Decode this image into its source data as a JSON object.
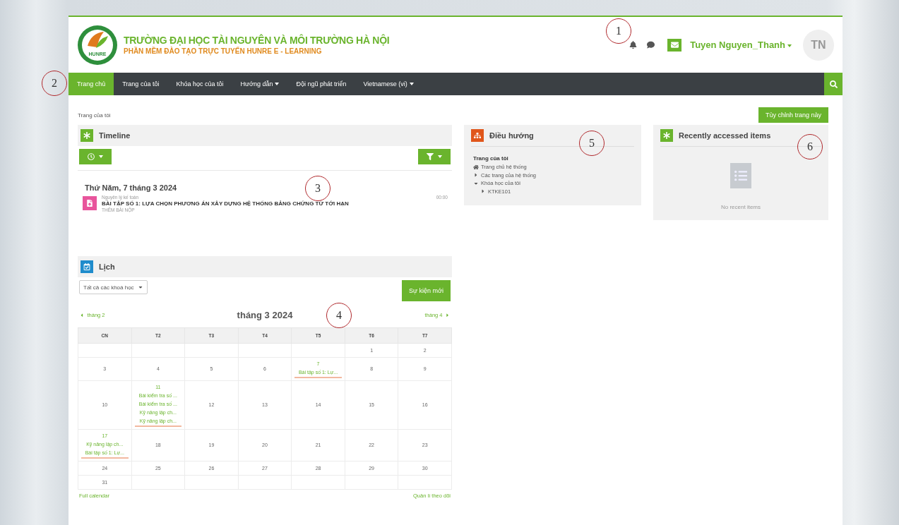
{
  "header": {
    "logo_text": "HUNRE",
    "title": "TRƯỜNG ĐẠI HỌC TÀI NGUYÊN VÀ MÔI TRƯỜNG HÀ NỘI",
    "subtitle": "PHẦN MỀM ĐÀO TẠO TRỰC TUYẾN HUNRE E - LEARNING",
    "user_name": "Tuyen Nguyen_Thanh",
    "avatar_initials": "TN"
  },
  "nav": {
    "items": [
      {
        "label": "Trang chủ",
        "selected": true,
        "has_menu": false
      },
      {
        "label": "Trang của tôi",
        "selected": false,
        "has_menu": false
      },
      {
        "label": "Khóa học của tôi",
        "selected": false,
        "has_menu": false
      },
      {
        "label": "Hướng dẫn",
        "selected": false,
        "has_menu": true
      },
      {
        "label": "Đội ngũ phát triển",
        "selected": false,
        "has_menu": false
      },
      {
        "label": "Vietnamese (vi)",
        "selected": false,
        "has_menu": true
      }
    ]
  },
  "breadcrumb": "Trang của tôi",
  "customize_button": "Tùy chỉnh trang này",
  "timeline": {
    "title": "Timeline",
    "date": "Thứ Năm, 7 tháng 3 2024",
    "events": [
      {
        "course": "Nguyên lý kế toán",
        "title": "BÀI TẬP SỐ 1: LỰA CHỌN PHƯƠNG ÁN XÂY DỰNG HỆ THỐNG BẢNG CHỨNG TỪ TỚI HẠN",
        "action": "THÊM BÀI NỘP",
        "time": "00:00"
      }
    ]
  },
  "calendar": {
    "title": "Lịch",
    "course_filter": "Tất cả các khoá học",
    "new_event_button": "Sự kiện mới",
    "prev_month": "tháng 2",
    "month_title": "tháng 3 2024",
    "next_month": "tháng 4",
    "weekdays": [
      "CN",
      "T2",
      "T3",
      "T4",
      "T5",
      "T6",
      "T7"
    ],
    "weeks": [
      {
        "pad_before": true,
        "days": [
          {
            "day": "1"
          },
          {
            "day": "2"
          }
        ]
      },
      {
        "days": [
          {
            "day": "3"
          },
          {
            "day": "4"
          },
          {
            "day": "5"
          },
          {
            "day": "6"
          },
          {
            "day": "7",
            "events": [
              "Bài tập số 1: Lự..."
            ]
          },
          {
            "day": "8"
          },
          {
            "day": "9"
          }
        ]
      },
      {
        "days": [
          {
            "day": "10"
          },
          {
            "day": "11",
            "events": [
              "Bài kiểm tra số ...",
              "Bài kiểm tra số ...",
              "Kỹ năng lập ch...",
              "Kỹ năng lập ch..."
            ]
          },
          {
            "day": "12"
          },
          {
            "day": "13"
          },
          {
            "day": "14"
          },
          {
            "day": "15"
          },
          {
            "day": "16"
          }
        ]
      },
      {
        "days": [
          {
            "day": "17",
            "events": [
              "Kỹ năng lập ch...",
              "Bài tập số 1: Lự..."
            ]
          },
          {
            "day": "18"
          },
          {
            "day": "19"
          },
          {
            "day": "20"
          },
          {
            "day": "21"
          },
          {
            "day": "22"
          },
          {
            "day": "23"
          }
        ]
      },
      {
        "days": [
          {
            "day": "24"
          },
          {
            "day": "25"
          },
          {
            "day": "26"
          },
          {
            "day": "27"
          },
          {
            "day": "28"
          },
          {
            "day": "29"
          },
          {
            "day": "30"
          }
        ]
      },
      {
        "days": [
          {
            "day": "31"
          }
        ]
      }
    ],
    "full_calendar_link": "Full calendar",
    "manage_link": "Quản lí theo dõi"
  },
  "navigation": {
    "title": "Điều hướng",
    "root": "Trang của tôi",
    "items": [
      {
        "label": "Trang chủ hệ thống",
        "kind": "home"
      },
      {
        "label": "Các trang của hệ thống",
        "kind": "branch",
        "expanded": false
      },
      {
        "label": "Khóa học của tôi",
        "kind": "branch",
        "expanded": true,
        "children": [
          {
            "label": "KTKE101",
            "kind": "branch",
            "expanded": false
          }
        ]
      }
    ]
  },
  "recent": {
    "title": "Recently accessed items",
    "empty_text": "No recent items"
  },
  "annotations": [
    "1",
    "2",
    "3",
    "4",
    "5",
    "6"
  ]
}
